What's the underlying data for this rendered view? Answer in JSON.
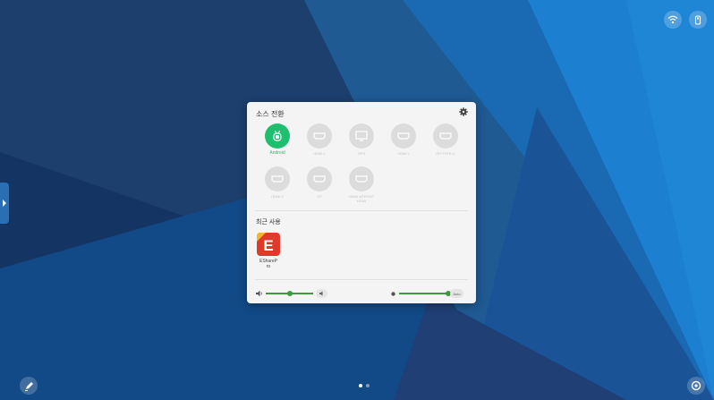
{
  "colors": {
    "accent_green": "#1fbf6f",
    "slider_green": "#3f9a3f",
    "app_red": "#e03a2c"
  },
  "status_icons": [
    "wifi-icon",
    "usb-icon"
  ],
  "panel": {
    "title": "소스 전환",
    "settings_icon": "gear-icon",
    "sources": [
      {
        "label": "Android",
        "icon": "android-icon",
        "active": true
      },
      {
        "label": "HDMI 1",
        "icon": "hdmi-icon",
        "active": false
      },
      {
        "label": "OPS",
        "icon": "monitor-icon",
        "active": false
      },
      {
        "label": "HDMI 2",
        "icon": "hdmi-icon",
        "active": false
      },
      {
        "label": "DP/TYPE-C",
        "icon": "hdmi-icon",
        "active": false
      },
      {
        "label": "HDMI 3",
        "icon": "hdmi-icon",
        "active": false
      },
      {
        "label": "DP",
        "icon": "hdmi-icon",
        "active": false
      },
      {
        "label": "HDMI 4/FRONT",
        "label2": "HDMI",
        "icon": "hdmi-icon",
        "active": false
      }
    ],
    "recent_title": "최근 사용",
    "recent_apps": [
      {
        "label": "EShareP",
        "label2": "ro",
        "icon": "eshare-app-icon",
        "letter": "E"
      }
    ],
    "volume": {
      "icon": "speaker-icon",
      "level": 0.5,
      "mute_icon": "mute-icon"
    },
    "brightness": {
      "icon": "brightness-icon",
      "level": 1.0,
      "auto_label": "Auto"
    }
  },
  "bottom": {
    "left_icon": "pen-icon",
    "right_icon": "settings-icon",
    "page_dots": 2,
    "active_dot": 0
  }
}
